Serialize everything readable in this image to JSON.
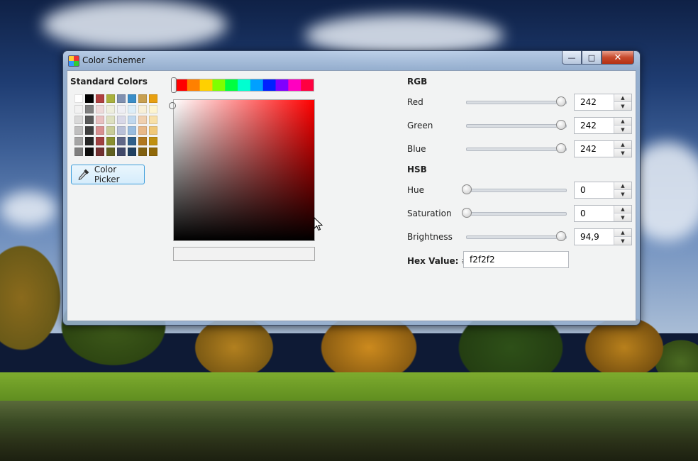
{
  "window": {
    "title": "Color Schemer",
    "minimize_glyph": "—",
    "maximize_glyph": "□",
    "close_glyph": "✕"
  },
  "standard_colors": {
    "title": "Standard Colors",
    "swatches": [
      "#ffffff",
      "#000000",
      "#b04040",
      "#a9b13c",
      "#8090b0",
      "#3a8ec8",
      "#c8a050",
      "#e8a010",
      "#f2f2f2",
      "#7f7f7f",
      "#eedada",
      "#eeeedd",
      "#eeeef4",
      "#ddeef8",
      "#f8f0d8",
      "#fdf5d0",
      "#d9d9d9",
      "#595959",
      "#e8c0c0",
      "#dde0c0",
      "#d8d8e8",
      "#c0d8ee",
      "#f0d0b0",
      "#f8e0a8",
      "#bfbfbf",
      "#3f3f3f",
      "#d89090",
      "#c8cc98",
      "#b8c0d8",
      "#98bcdf",
      "#e8b888",
      "#f0c878",
      "#a5a5a5",
      "#262626",
      "#a04040",
      "#8a9030",
      "#606888",
      "#30608a",
      "#b07820",
      "#c09010",
      "#7f7f7f",
      "#0d0d0d",
      "#703030",
      "#606020",
      "#404868",
      "#204060",
      "#806010",
      "#906808"
    ]
  },
  "picker": {
    "button_label": "Color Picker",
    "icon": "eyedropper-icon",
    "hue_colors": [
      "#ff0000",
      "#ff8000",
      "#ffd000",
      "#80ff00",
      "#00ff40",
      "#00ffd0",
      "#00a0ff",
      "#0020ff",
      "#8000ff",
      "#ff00c0",
      "#ff0040"
    ],
    "selected_hue_fraction": 0,
    "preview_color": "#f2f2f2"
  },
  "rgb": {
    "title": "RGB",
    "red": {
      "label": "Red",
      "value": "242",
      "fraction": 0.949
    },
    "green": {
      "label": "Green",
      "value": "242",
      "fraction": 0.949
    },
    "blue": {
      "label": "Blue",
      "value": "242",
      "fraction": 0.949
    }
  },
  "hsb": {
    "title": "HSB",
    "hue": {
      "label": "Hue",
      "value": "0",
      "fraction": 0
    },
    "saturation": {
      "label": "Saturation",
      "value": "0",
      "fraction": 0
    },
    "brightness": {
      "label": "Brightness",
      "value": "94,9",
      "fraction": 0.949
    }
  },
  "hex": {
    "label": "Hex Value: #",
    "value": "f2f2f2"
  }
}
